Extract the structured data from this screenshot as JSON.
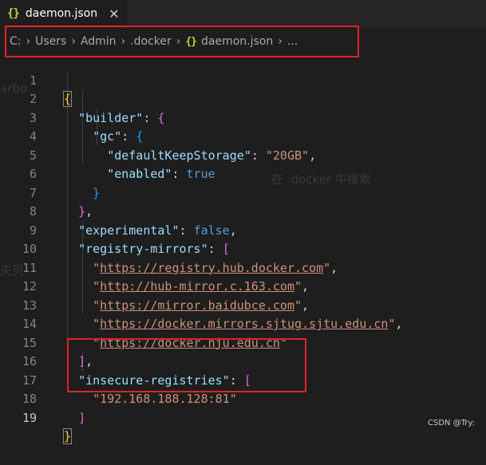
{
  "tab": {
    "icon": "{}",
    "title": "daemon.json",
    "close": "✕"
  },
  "breadcrumb": [
    "C:",
    "Users",
    "Admin",
    ".docker",
    "daemon.json",
    "..."
  ],
  "breadcrumb_file_icon": "{}",
  "breadcrumb_sep": "›",
  "watermarks": {
    "search_hint": "在 .docker 中搜索",
    "left1": "arbo",
    "left2": "失贝"
  },
  "line_numbers": [
    "1",
    "2",
    "3",
    "4",
    "5",
    "6",
    "7",
    "8",
    "9",
    "10",
    "11",
    "12",
    "13",
    "14",
    "15",
    "16",
    "17",
    "18",
    "19"
  ],
  "json": {
    "builder_key": "\"builder\"",
    "gc_key": "\"gc\"",
    "dks_key": "\"defaultKeepStorage\"",
    "dks_val": "\"20GB\"",
    "enabled_key": "\"enabled\"",
    "enabled_val": "true",
    "experimental_key": "\"experimental\"",
    "experimental_val": "false",
    "mirrors_key": "\"registry-mirrors\"",
    "mirrors": [
      "https://registry.hub.docker.com",
      "http://hub-mirror.c.163.com",
      "https://mirror.baidubce.com",
      "https://docker.mirrors.sjtug.sjtu.edu.cn",
      "https://docker.nju.edu.cn"
    ],
    "insecure_key": "\"insecure-registries\"",
    "insecure_val": "\"192.168.188.128:81\""
  },
  "footer": "CSDN @Try:"
}
